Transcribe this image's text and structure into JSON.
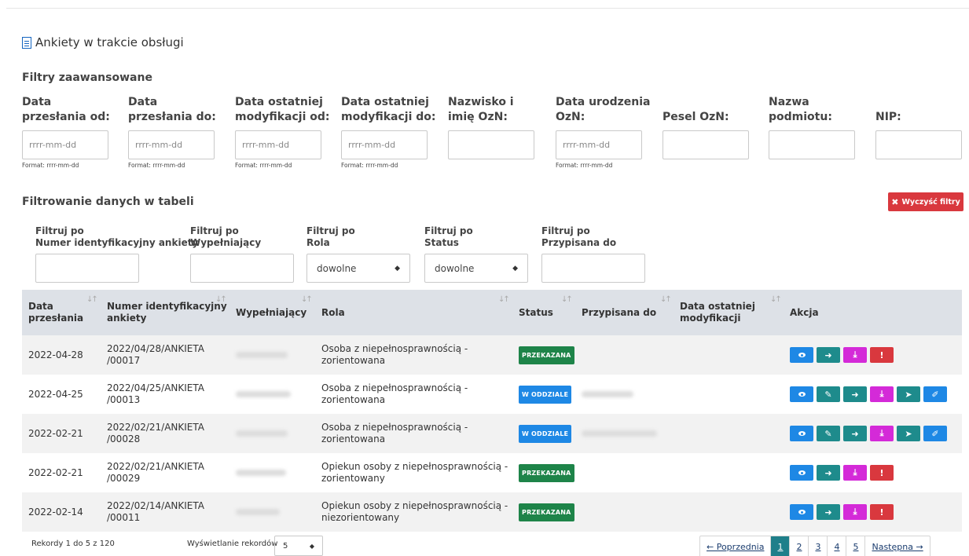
{
  "header": {
    "title": "Ankiety w trakcie obsługi"
  },
  "advanced_filters": {
    "heading": "Filtry zaawansowane",
    "fields": [
      {
        "label_l1": "Data",
        "label_l2": "przesłania od:",
        "placeholder": "rrrr-mm-dd",
        "hint": "Format: rrrr-mm-dd"
      },
      {
        "label_l1": "Data",
        "label_l2": "przesłania do:",
        "placeholder": "rrrr-mm-dd",
        "hint": "Format: rrrr-mm-dd"
      },
      {
        "label_l1": "Data ostatniej",
        "label_l2": "modyfikacji od:",
        "placeholder": "rrrr-mm-dd",
        "hint": "Format: rrrr-mm-dd"
      },
      {
        "label_l1": "Data ostatniej",
        "label_l2": "modyfikacji do:",
        "placeholder": "rrrr-mm-dd",
        "hint": "Format: rrrr-mm-dd"
      },
      {
        "label_l1": "Nazwisko i",
        "label_l2": "imię OzN:",
        "placeholder": "",
        "hint": ""
      },
      {
        "label_l1": "Data urodzenia",
        "label_l2": "OzN:",
        "placeholder": "rrrr-mm-dd",
        "hint": "Format: rrrr-mm-dd"
      },
      {
        "label_l1": "",
        "label_l2": "Pesel OzN:",
        "placeholder": "",
        "hint": ""
      },
      {
        "label_l1": "Nazwa",
        "label_l2": "podmiotu:",
        "placeholder": "",
        "hint": ""
      },
      {
        "label_l1": "",
        "label_l2": "NIP:",
        "placeholder": "",
        "hint": ""
      }
    ]
  },
  "table_filters": {
    "heading": "Filtrowanie danych w tabeli",
    "clear_label": "Wyczyść filtry",
    "filters": [
      {
        "l1": "Filtruj po",
        "l2": "Numer identyfikacyjny ankiety"
      },
      {
        "l1": "Filtruj po",
        "l2": "Wypełniający"
      },
      {
        "l1": "Filtruj po",
        "l2": "Rola",
        "value": "dowolne"
      },
      {
        "l1": "Filtruj po",
        "l2": "Status",
        "value": "dowolne"
      },
      {
        "l1": "Filtruj po",
        "l2": "Przypisana do"
      }
    ]
  },
  "table": {
    "headers": {
      "date_l1": "Data",
      "date_l2": "przesłania",
      "id_l1": "Numer identyfikacyjny",
      "id_l2": "ankiety",
      "filler": "Wypełniający",
      "role": "Rola",
      "status": "Status",
      "assigned": "Przypisana do",
      "mod_l1": "Data ostatniej",
      "mod_l2": "modyfikacji",
      "action": "Akcja"
    },
    "rows": [
      {
        "date": "2022-04-28",
        "id_l1": "2022/04/28/ANKIETA",
        "id_l2": "/00017",
        "role_l1": "Osoba z niepełnosprawnością -",
        "role_l2": "zorientowana",
        "status": "PRZEKAZANA",
        "status_color": "#1e8449",
        "assigned": false,
        "actions": [
          "view",
          "forward",
          "download",
          "alert"
        ]
      },
      {
        "date": "2022-04-25",
        "id_l1": "2022/04/25/ANKIETA",
        "id_l2": "/00013",
        "role_l1": "Osoba z niepełnosprawnością -",
        "role_l2": "zorientowana",
        "status": "W ODDZIALE",
        "status_color": "#1e88e5",
        "assigned": true,
        "actions": [
          "view",
          "edit",
          "forward",
          "download",
          "send",
          "external"
        ]
      },
      {
        "date": "2022-02-21",
        "id_l1": "2022/02/21/ANKIETA",
        "id_l2": "/00028",
        "role_l1": "Osoba z niepełnosprawnością -",
        "role_l2": "zorientowana",
        "status": "W ODDZIALE",
        "status_color": "#1e88e5",
        "assigned": true,
        "actions": [
          "view",
          "edit",
          "forward",
          "download",
          "send",
          "external"
        ]
      },
      {
        "date": "2022-02-21",
        "id_l1": "2022/02/21/ANKIETA",
        "id_l2": "/00029",
        "role_l1": "Opiekun osoby z niepełnosprawnością -",
        "role_l2": "zorientowany",
        "status": "PRZEKAZANA",
        "status_color": "#1e8449",
        "assigned": false,
        "actions": [
          "view",
          "forward",
          "download",
          "alert"
        ]
      },
      {
        "date": "2022-02-14",
        "id_l1": "2022/02/14/ANKIETA",
        "id_l2": "/00011",
        "role_l1": "Opiekun osoby z niepełnosprawnością -",
        "role_l2": "niezorientowany",
        "status": "PRZEKAZANA",
        "status_color": "#1e8449",
        "assigned": false,
        "actions": [
          "view",
          "forward",
          "download",
          "alert"
        ]
      }
    ]
  },
  "footer": {
    "records_info": "Rekordy 1 do 5 z 120",
    "per_page_label": "Wyświetlanie rekordów",
    "per_page_value": "5",
    "prev": "← Poprzednia",
    "pages": [
      "1",
      "2",
      "3",
      "4",
      "5"
    ],
    "active_page": "1",
    "next": "Następna →"
  }
}
